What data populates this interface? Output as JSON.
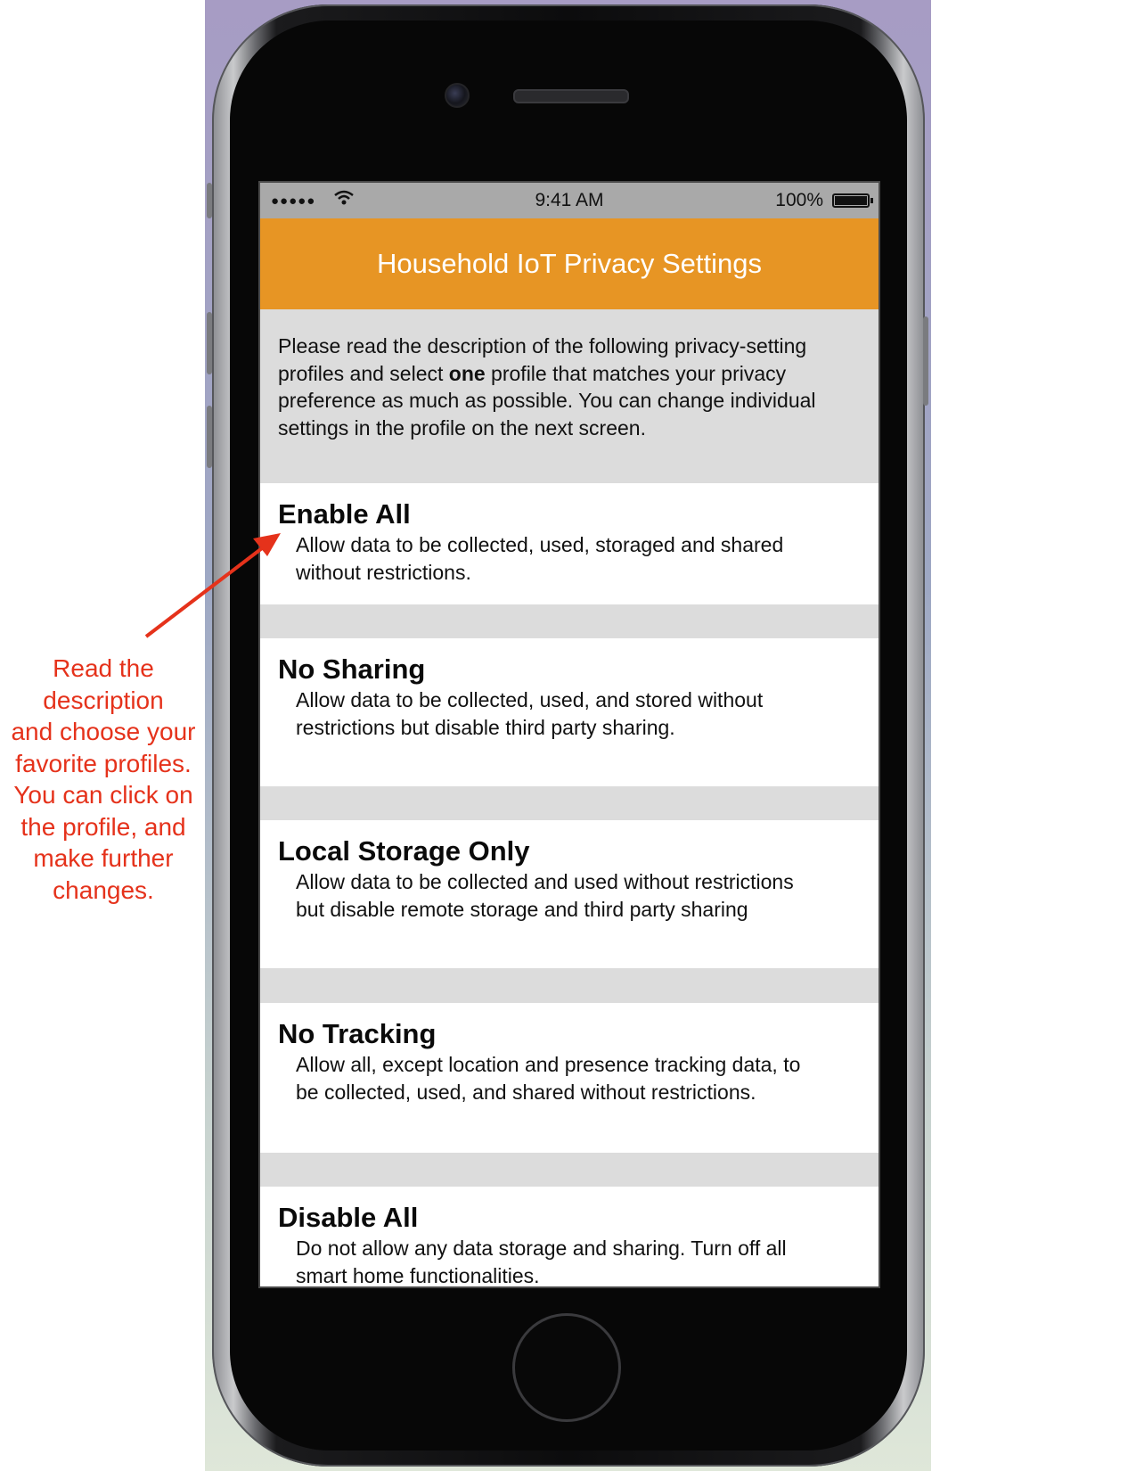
{
  "status_bar": {
    "signal": "●●●●●",
    "time": "9:41 AM",
    "battery": "100%"
  },
  "header": {
    "title": "Household IoT Privacy Settings"
  },
  "intro": {
    "before": "Please read the description of the following privacy-setting profiles and select ",
    "bold": "one",
    "after": " profile that matches your privacy preference as much as possible. You can change individual settings in the profile on the next screen."
  },
  "profiles": [
    {
      "title": "Enable All",
      "description": "Allow data to be collected, used, storaged and shared without restrictions."
    },
    {
      "title": "No Sharing",
      "description": "Allow data to be collected, used, and stored without restrictions but disable third party sharing."
    },
    {
      "title": "Local Storage Only",
      "description": "Allow data to be collected and used without restrictions but disable remote storage and third party sharing"
    },
    {
      "title": "No Tracking",
      "description": "Allow all, except location and presence tracking data, to be collected, used, and shared without restrictions."
    },
    {
      "title": "Disable All",
      "description": "Do not allow any data storage and sharing. Turn off all smart home functionalities."
    }
  ],
  "annotation": {
    "lines": [
      "Read the",
      "description",
      "and choose your",
      "favorite profiles.",
      "You can click on",
      "the profile, and",
      "make further",
      "changes."
    ],
    "color": "#e5321b"
  },
  "colors": {
    "header": "#e79524",
    "background": "#dcdcdc",
    "card": "#ffffff"
  }
}
